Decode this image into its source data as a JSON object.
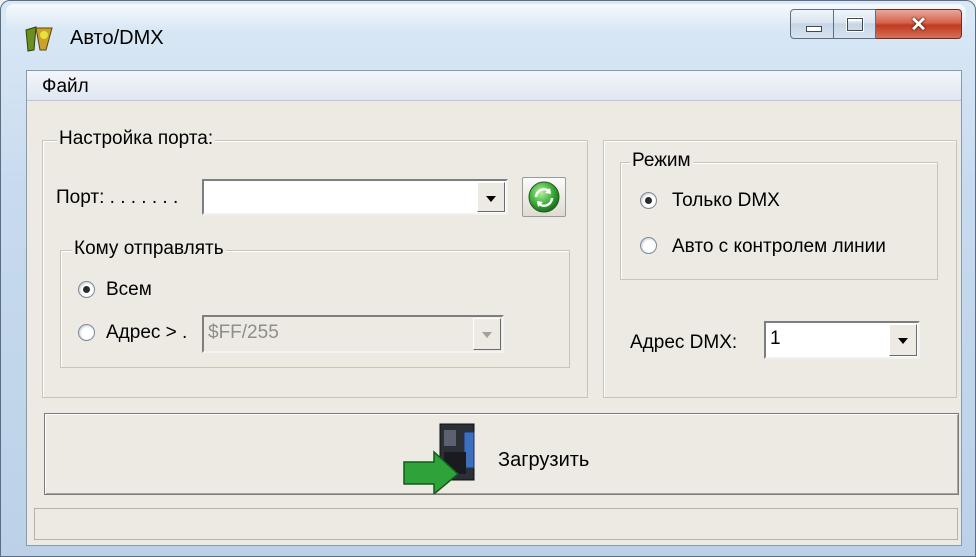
{
  "window": {
    "title": "Авто/DMX"
  },
  "menu": {
    "items": [
      "Файл"
    ]
  },
  "port_settings": {
    "legend": "Настройка порта:",
    "port_label": "Порт: . . . . . . .",
    "port_value": "",
    "recipient_group": {
      "legend": "Кому отправлять",
      "options": [
        {
          "label": "Всем",
          "selected": true
        },
        {
          "label": "Адрес > .",
          "selected": false
        }
      ],
      "address_value": "$FF/255"
    }
  },
  "mode": {
    "legend": "Режим",
    "options": [
      {
        "label": "Только DMX",
        "selected": true
      },
      {
        "label": "Авто с контролем линии",
        "selected": false
      }
    ]
  },
  "dmx_address": {
    "label": "Адрес DMX:",
    "value": "1"
  },
  "load_button": {
    "label": "Загрузить"
  },
  "icons": {
    "app": "app-icon",
    "refresh": "refresh-icon",
    "load": "upload-device-icon"
  },
  "colors": {
    "close_button": "#c9442b",
    "refresh_green": "#3fae3c"
  }
}
